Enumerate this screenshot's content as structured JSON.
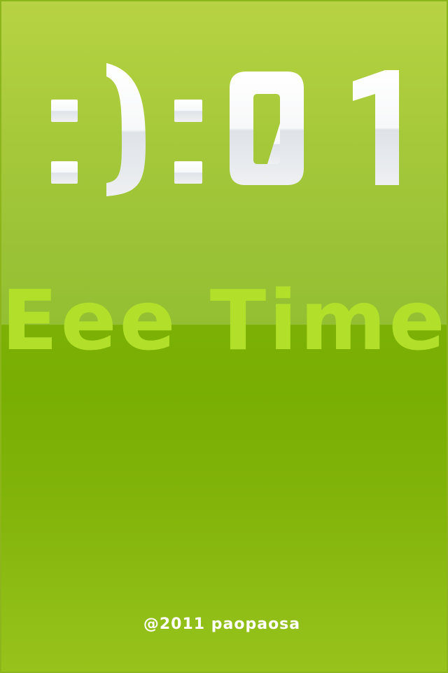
{
  "clock_display": {
    "text": ":):01",
    "glyphs": [
      ":",
      ")",
      ":",
      "0",
      "1"
    ]
  },
  "app_title": "Eee Timer",
  "copyright": "@2011 paopaosa",
  "colors": {
    "background_top": "#b7d343",
    "background_bottom": "#7cb004",
    "title": "#b2e02a",
    "digits": "#ffffff",
    "copyright": "#ffffff"
  }
}
